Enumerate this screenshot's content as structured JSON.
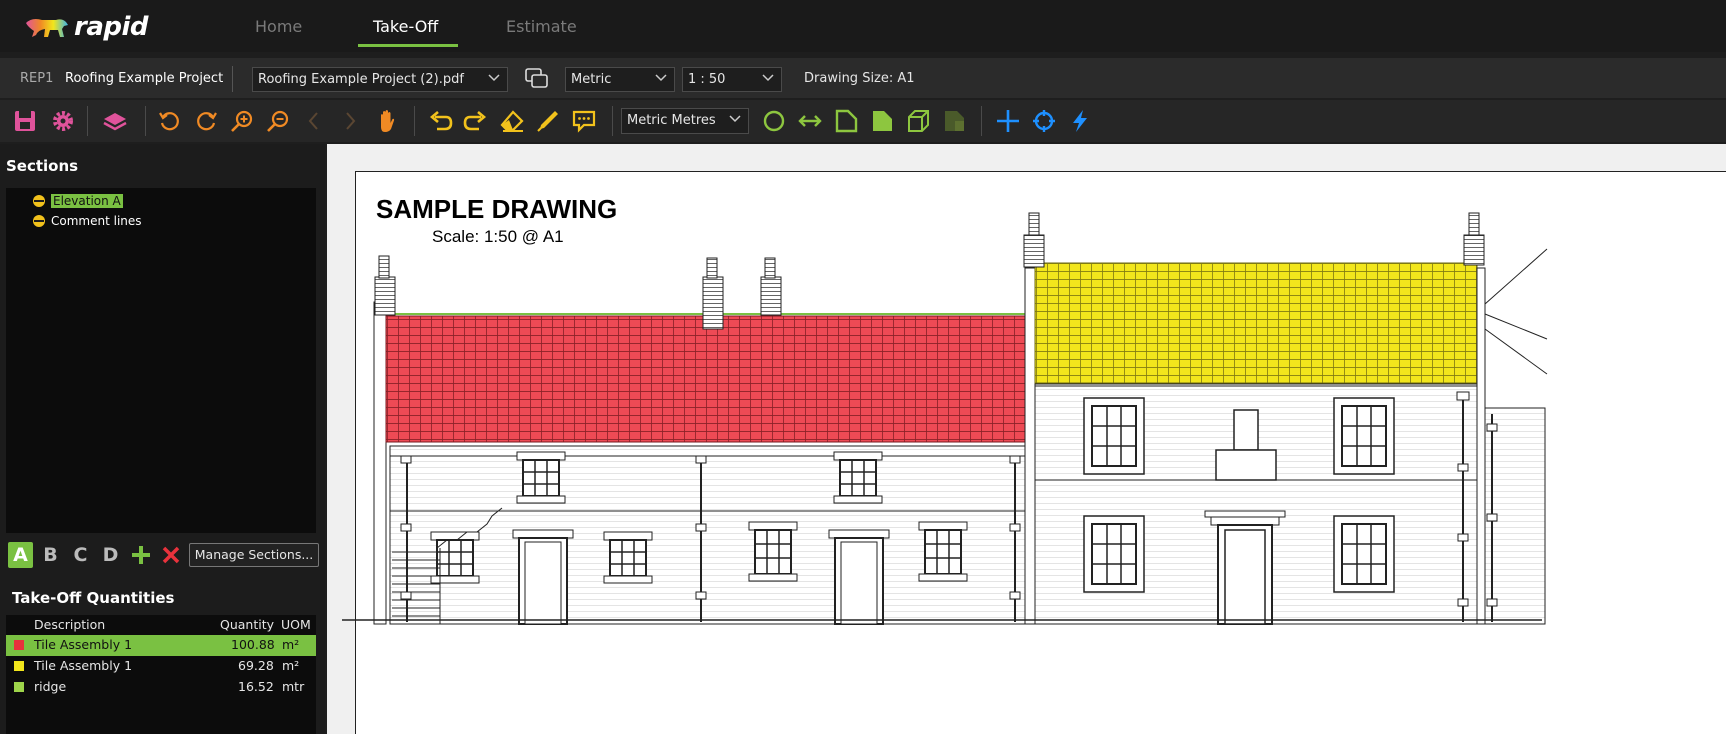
{
  "app": {
    "brand": "rapid"
  },
  "nav": {
    "tabs": [
      "Home",
      "Take-Off",
      "Estimate"
    ],
    "active": "Take-Off"
  },
  "project": {
    "code": "REP1",
    "name": "Roofing Example Project",
    "file": "Roofing Example Project (2).pdf",
    "units": "Metric",
    "scale": "1 : 50",
    "drawing_size": "Drawing Size: A1"
  },
  "toolbar": {
    "measure_units": "Metric Metres",
    "icons": [
      "save-icon",
      "settings-icon",
      "layers-icon",
      "rotate-left-icon",
      "rotate-right-icon",
      "zoom-in-icon",
      "zoom-out-icon",
      "previous-page-icon",
      "next-page-icon",
      "pan-hand-icon",
      "undo-icon",
      "redo-icon",
      "eraser-icon",
      "pen-icon",
      "comment-icon",
      "circle-tool-icon",
      "linear-measure-icon",
      "area-outline-icon",
      "area-fill-icon",
      "volume-icon",
      "deduction-icon",
      "add-point-icon",
      "snap-icon",
      "quick-takeoff-icon"
    ]
  },
  "sections": {
    "title": "Sections",
    "items": [
      {
        "label": "Elevation A",
        "selected": true
      },
      {
        "label": "Comment lines",
        "selected": false
      }
    ],
    "letters": [
      "A",
      "B",
      "C",
      "D"
    ],
    "active_letter": "A",
    "manage_label": "Manage Sections..."
  },
  "takeoff": {
    "title": "Take-Off Quantities",
    "columns": [
      "Description",
      "Quantity",
      "UOM"
    ],
    "rows": [
      {
        "swatch": "#e8323c",
        "description": "Tile Assembly 1",
        "quantity": "100.88",
        "uom": "m²",
        "selected": true
      },
      {
        "swatch": "#f2e61c",
        "description": "Tile Assembly 1",
        "quantity": "69.28",
        "uom": "m²",
        "selected": false
      },
      {
        "swatch": "#9ed44a",
        "description": "ridge",
        "quantity": "16.52",
        "uom": "mtr",
        "selected": false
      }
    ]
  },
  "drawing": {
    "title": "SAMPLE DRAWING",
    "scale_text": "Scale: 1:50 @ A1"
  },
  "colors": {
    "accent": "#7ac142",
    "roof_red": "#ee4a55",
    "roof_yellow": "#f2e61c",
    "tool_orange": "#f08a24",
    "tool_blue": "#1e90ff",
    "tool_green": "#8dc63f",
    "tool_pink": "#e0539b"
  }
}
